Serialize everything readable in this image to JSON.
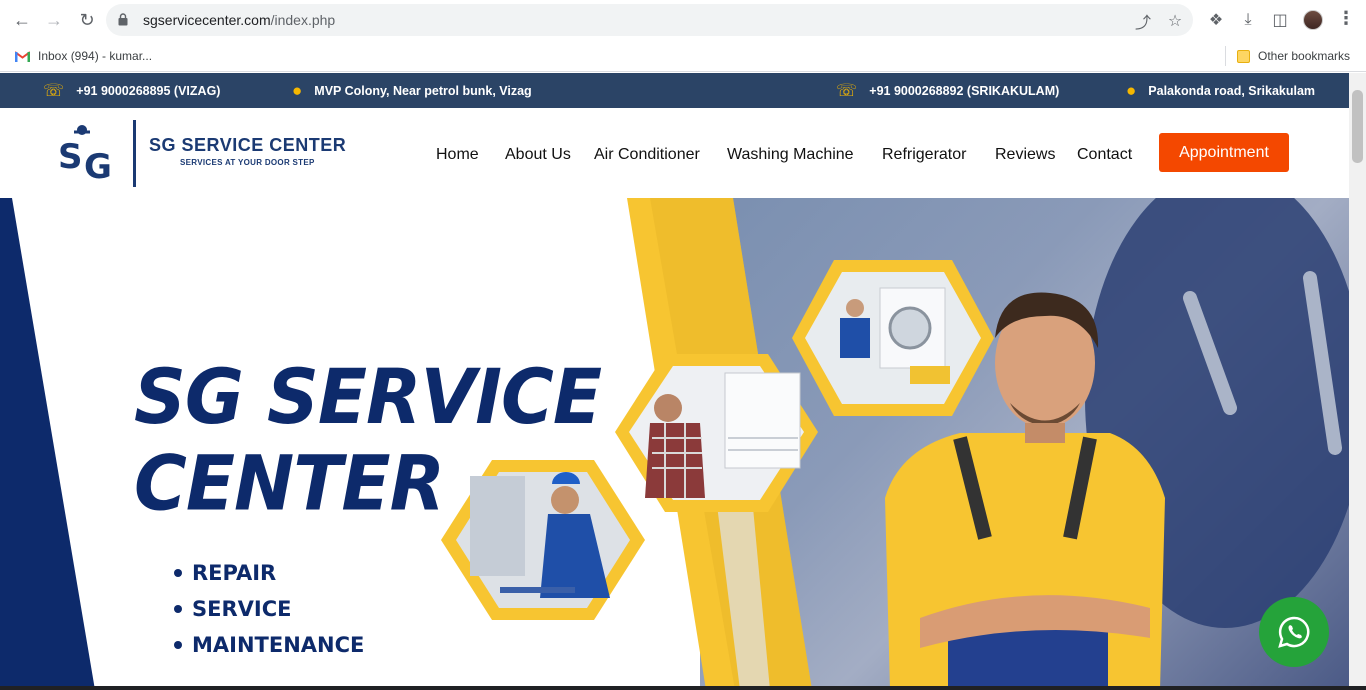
{
  "browser": {
    "url_domain": "sgservicecenter.com",
    "url_path": "/index.php",
    "bookmarks": [
      {
        "label": "Inbox (994) - kumar..."
      },
      {
        "label": "Other bookmarks"
      }
    ]
  },
  "topbar": {
    "phone_vizag": "+91 9000268895 (VIZAG)",
    "address_vizag": "MVP Colony, Near petrol bunk, Vizag",
    "phone_srikakulam": "+91 9000268892 (SRIKAKULAM)",
    "address_srikakulam": "Palakonda road, Srikakulam"
  },
  "logo": {
    "title": "SG SERVICE CENTER",
    "subtitle": "SERVICES AT YOUR DOOR STEP"
  },
  "nav": {
    "items": [
      "Home",
      "About Us",
      "Air Conditioner",
      "Washing Machine",
      "Refrigerator",
      "Reviews",
      "Contact"
    ],
    "cta": "Appointment"
  },
  "hero": {
    "title_line1": "SG SERVICE",
    "title_line2": "CENTER",
    "bullets": [
      "REPAIR",
      "SERVICE",
      "MAINTENANCE"
    ]
  },
  "colors": {
    "topbar": "#2b4466",
    "brand_navy": "#0d2a6b",
    "accent_yellow": "#f7c531",
    "cta_orange": "#f44800",
    "whatsapp_green": "#25a33a"
  }
}
